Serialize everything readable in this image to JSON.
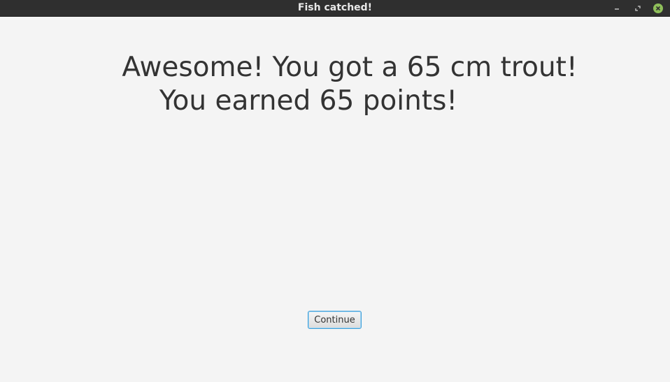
{
  "window": {
    "title": "Fish catched!"
  },
  "message": {
    "line1": "Awesome! You got a 65 cm trout!",
    "line2": "You earned 65 points!"
  },
  "buttons": {
    "continue_label": "Continue"
  },
  "colors": {
    "titlebar": "#2f2f2f",
    "background": "#f4f4f4",
    "close_button": "#8fbf5a",
    "focus_border": "#3d9fd9"
  }
}
